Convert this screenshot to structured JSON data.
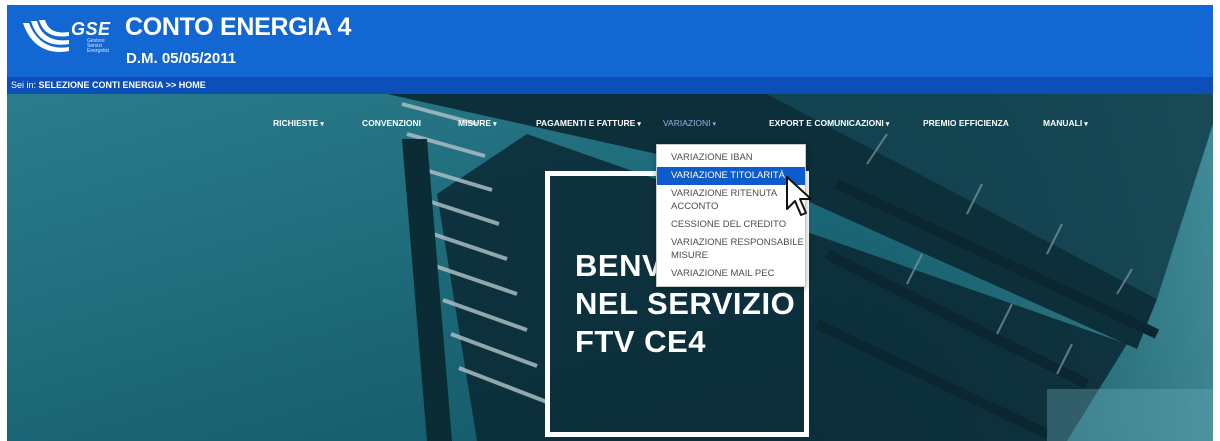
{
  "header": {
    "logo_text": "GSE",
    "logo_sub": "Gestore Servizi Energetici",
    "title": "CONTO ENERGIA 4",
    "subtitle": "D.M. 05/05/2011"
  },
  "breadcrumb": {
    "prefix": "Sei in:",
    "path": "SELEZIONE CONTI ENERGIA >> HOME"
  },
  "nav": {
    "items": [
      {
        "label": "RICHIESTE"
      },
      {
        "label": "CONVENZIONI"
      },
      {
        "label": "MISURE"
      },
      {
        "label": "PAGAMENTI E FATTURE"
      },
      {
        "label": "VARIAZIONI"
      },
      {
        "label": "EXPORT E COMUNICAZIONI"
      },
      {
        "label": "PREMIO EFFICIENZA"
      },
      {
        "label": "MANUALI"
      }
    ],
    "caret": "▾"
  },
  "dropdown": {
    "items": [
      {
        "label": "VARIAZIONE IBAN"
      },
      {
        "label": "VARIAZIONE TITOLARITÀ"
      },
      {
        "label": "VARIAZIONE RITENUTA ACCONTO"
      },
      {
        "label": "CESSIONE DEL CREDITO"
      },
      {
        "label": "VARIAZIONE RESPONSABILE MISURE"
      },
      {
        "label": "VARIAZIONE MAIL PEC"
      }
    ],
    "highlighted_index": 1
  },
  "hero": {
    "line1": "BENVENUTO",
    "line2": "NEL SERVIZIO",
    "line3": "FTV CE4"
  },
  "colors": {
    "header_blue": "#1267d2",
    "breadcrumb_blue": "#0d4fb8",
    "highlight_blue": "#0e5bcc"
  }
}
